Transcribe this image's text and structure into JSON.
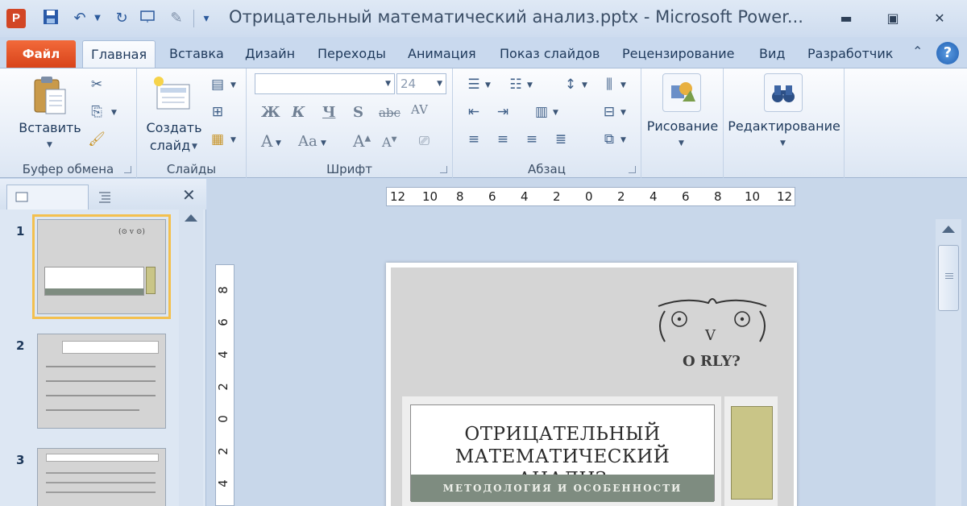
{
  "window": {
    "app_icon": "P",
    "title": "Отрицательный математический анализ.pptx - Microsoft Power..."
  },
  "tabs": {
    "file": "Файл",
    "items": [
      "Главная",
      "Вставка",
      "Дизайн",
      "Переходы",
      "Анимация",
      "Показ слайдов",
      "Рецензирование",
      "Вид",
      "Разработчик"
    ],
    "help": "?"
  },
  "ribbon": {
    "clipboard": {
      "paste": "Вставить",
      "label": "Буфер обмена"
    },
    "slides": {
      "new_slide_1": "Создать",
      "new_slide_2": "слайд",
      "label": "Слайды"
    },
    "font": {
      "font_name": "",
      "font_size": "24",
      "label": "Шрифт"
    },
    "paragraph": {
      "label": "Абзац"
    },
    "drawing": {
      "label": "Рисование"
    },
    "editing": {
      "label": "Редактирование"
    }
  },
  "thumbnails": {
    "numbers": [
      "1",
      "2",
      "3"
    ]
  },
  "rulers": {
    "horizontal": [
      "12",
      "10",
      "8",
      "6",
      "4",
      "2",
      "0",
      "2",
      "4",
      "6",
      "8",
      "10",
      "12"
    ],
    "vertical": [
      "8",
      "6",
      "4",
      "2",
      "0",
      "2",
      "4"
    ]
  },
  "slide": {
    "owl_face": "V",
    "orly": "O RLY?",
    "title_line1": "ОТРИЦАТЕЛЬНЫЙ",
    "title_line2": "МАТЕМАТИЧЕСКИЙ АНАЛИЗ",
    "subtitle": "МЕТОДОЛОГИЯ И ОСОБЕННОСТИ"
  },
  "colors": {
    "file_tab": "#d8431a",
    "selection": "#f3c04f",
    "subtitle_band": "#7e8c80",
    "side_rect": "#c9c587"
  }
}
